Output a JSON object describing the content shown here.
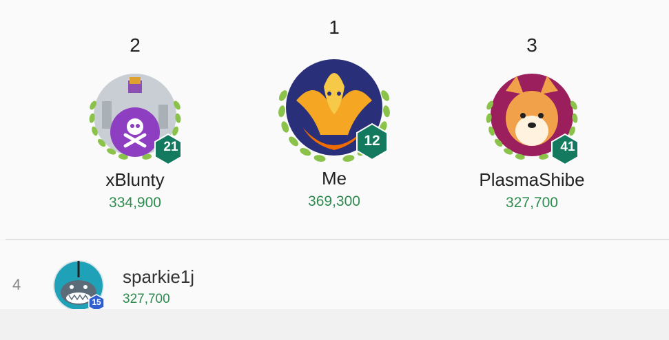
{
  "podium": [
    {
      "rank": "2",
      "name": "xBlunty",
      "score": "334,900",
      "level": "21",
      "avatar": "poison-potion-skull-icon"
    },
    {
      "rank": "1",
      "name": "Me",
      "score": "369,300",
      "level": "12",
      "avatar": "phoenix-icon"
    },
    {
      "rank": "3",
      "name": "PlasmaShibe",
      "score": "327,700",
      "level": "41",
      "avatar": "shiba-dog-icon"
    }
  ],
  "list": [
    {
      "rank": "4",
      "name": "sparkie1j",
      "score": "327,700",
      "level": "15",
      "avatar": "shark-icon"
    }
  ],
  "colors": {
    "score_green": "#2e8b4f",
    "level_badge_green": "#137a5f",
    "level_badge_blue": "#2f5fd1",
    "laurel_green": "#8bc34a"
  }
}
